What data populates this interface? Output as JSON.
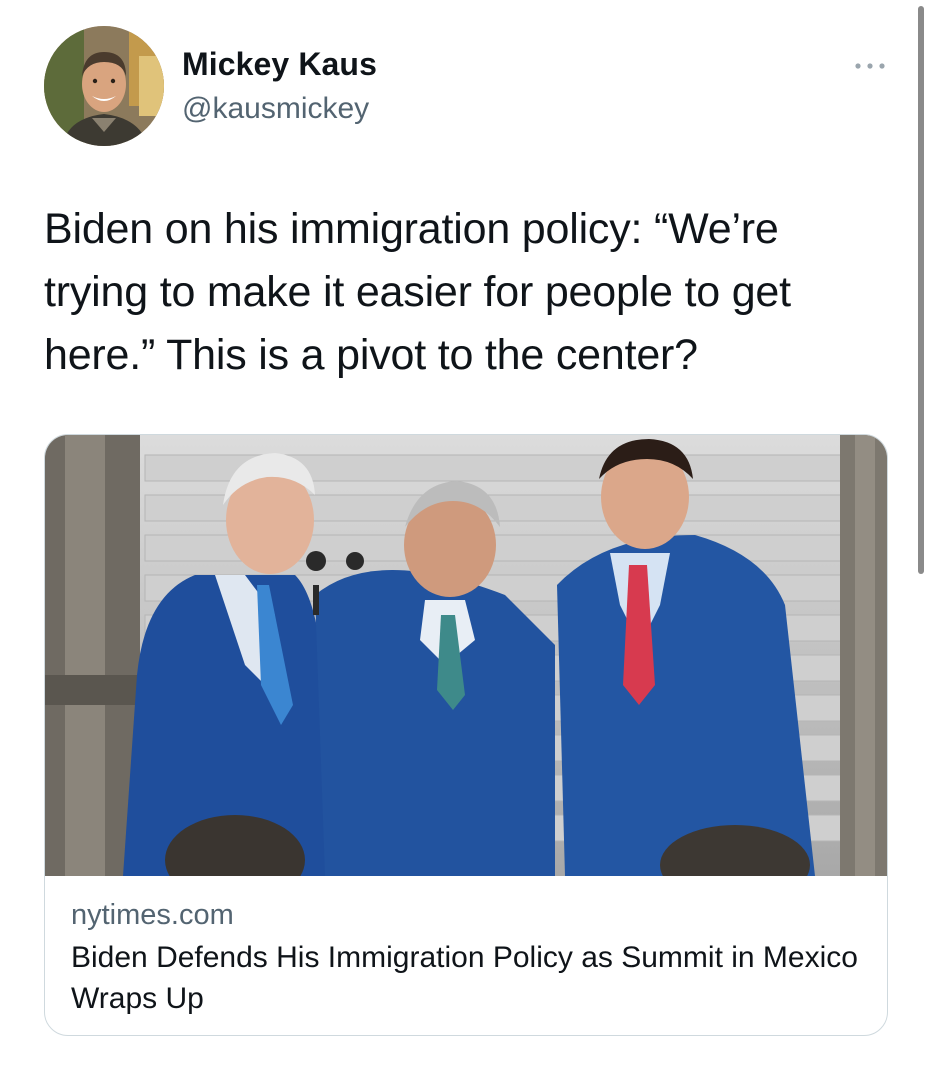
{
  "tweet": {
    "author": {
      "name": "Mickey Kaus",
      "handle": "@kausmickey"
    },
    "more_icon": "ellipsis-icon",
    "text": "Biden on his immigration policy: “We’re trying to make it easier for people to get here.” This is a pivot to the center?",
    "link_card": {
      "domain": "nytimes.com",
      "title": "Biden Defends His Immigration Policy as Summit in Mexico Wraps Up"
    }
  },
  "colors": {
    "text_primary": "#0f1419",
    "text_secondary": "#536471",
    "card_border": "#cfd9de",
    "suit_blue": "#1f4e9c"
  }
}
